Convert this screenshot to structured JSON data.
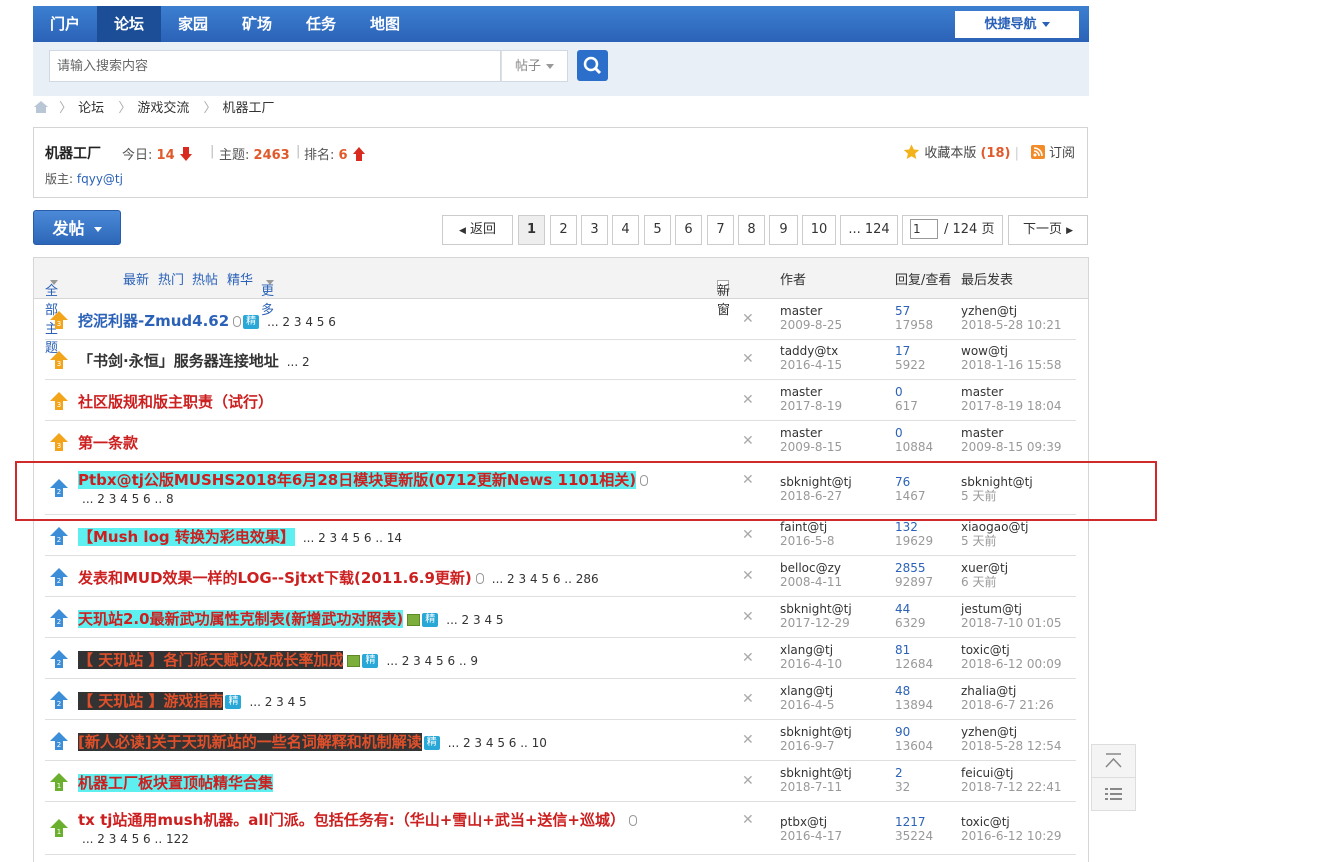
{
  "nav": {
    "items": [
      "门户",
      "论坛",
      "家园",
      "矿场",
      "任务",
      "地图"
    ],
    "active": 1,
    "quick": "快捷导航"
  },
  "search": {
    "placeholder": "请输入搜索内容",
    "type": "帖子"
  },
  "breadcrumb": [
    "论坛",
    "游戏交流",
    "机器工厂"
  ],
  "forum": {
    "name": "机器工厂",
    "today_label": "今日:",
    "today": "14",
    "threads_label": "主题:",
    "threads": "2463",
    "rank_label": "排名:",
    "rank": "6",
    "moderator_label": "版主:",
    "moderator": "fqyy@tj",
    "favorite_label": "收藏本版",
    "favorite_count": "(18)",
    "subscribe_label": "订阅"
  },
  "post_button": "发帖",
  "pager": {
    "prev": "返回",
    "pages": [
      "1",
      "2",
      "3",
      "4",
      "5",
      "6",
      "7",
      "8",
      "9",
      "10"
    ],
    "last": "... 124",
    "current_input": "1",
    "total": "/ 124 页",
    "next": "下一页"
  },
  "list_header": {
    "filters": [
      "全部主题",
      "最新",
      "热门",
      "热帖",
      "精华",
      "更多"
    ],
    "new_window": "新窗",
    "author": "作者",
    "replies": "回复/查看",
    "last_post": "最后发表"
  },
  "colors": {
    "accent": "#2b62b8",
    "red": "#cc1f1f",
    "cyan_hl": "#5ef0f0",
    "dark_hl": "#333333",
    "orange_num": "#e05a2b"
  },
  "threads": [
    {
      "title": "挖泥利器-Zmud4.62",
      "pages": "... 2 3 4 5 6",
      "author": "master",
      "adate": "2009-8-25",
      "replies": "57",
      "views": "17958",
      "last": "yzhen@tj",
      "ldate": "2018-5-28 10:21"
    },
    {
      "title": "「书剑·永恒」服务器连接地址",
      "pages": "... 2",
      "author": "taddy@tx",
      "adate": "2016-4-15",
      "replies": "17",
      "views": "5922",
      "last": "wow@tj",
      "ldate": "2018-1-16 15:58"
    },
    {
      "title": "社区版规和版主职责（试行）",
      "pages": "",
      "author": "master",
      "adate": "2017-8-19",
      "replies": "0",
      "views": "617",
      "last": "master",
      "ldate": "2017-8-19 18:04"
    },
    {
      "title": "第一条款",
      "pages": "",
      "author": "master",
      "adate": "2009-8-15",
      "replies": "0",
      "views": "10884",
      "last": "master",
      "ldate": "2009-8-15 09:39"
    },
    {
      "title": "Ptbx@tj公版MUSHS2018年6月28日模块更新版(0712更新News 1101相关)",
      "pages": "... 2 3 4 5 6 .. 8",
      "author": "sbknight@tj",
      "adate": "2018-6-27",
      "replies": "76",
      "views": "1467",
      "last": "sbknight@tj",
      "ldate": "5 天前"
    },
    {
      "title": "【Mush log 转换为彩电效果】",
      "pages": "... 2 3 4 5 6 .. 14",
      "author": "faint@tj",
      "adate": "2016-5-8",
      "replies": "132",
      "views": "19629",
      "last": "xiaogao@tj",
      "ldate": "5 天前"
    },
    {
      "title": "发表和MUD效果一样的LOG--Sjtxt下载(2011.6.9更新)",
      "pages": "... 2 3 4 5 6 .. 286",
      "author": "belloc@zy",
      "adate": "2008-4-11",
      "replies": "2855",
      "views": "92897",
      "last": "xuer@tj",
      "ldate": "6 天前"
    },
    {
      "title": "天玑站2.0最新武功属性克制表(新增武功对照表)",
      "pages": "... 2 3 4 5",
      "author": "sbknight@tj",
      "adate": "2017-12-29",
      "replies": "44",
      "views": "6329",
      "last": "jestum@tj",
      "ldate": "2018-7-10 01:05"
    },
    {
      "title": "【 天玑站 】各门派天赋以及成长率加成",
      "pages": "... 2 3 4 5 6 .. 9",
      "author": "xlang@tj",
      "adate": "2016-4-10",
      "replies": "81",
      "views": "12684",
      "last": "toxic@tj",
      "ldate": "2018-6-12 00:09"
    },
    {
      "title": "【 天玑站 】游戏指南",
      "pages": "... 2 3 4 5",
      "author": "xlang@tj",
      "adate": "2016-4-5",
      "replies": "48",
      "views": "13894",
      "last": "zhalia@tj",
      "ldate": "2018-6-7 21:26"
    },
    {
      "title": "[新人必读]关于天玑新站的一些名词解释和机制解读",
      "pages": "... 2 3 4 5 6 .. 10",
      "author": "sbknight@tj",
      "adate": "2016-9-7",
      "replies": "90",
      "views": "13604",
      "last": "yzhen@tj",
      "ldate": "2018-5-28 12:54"
    },
    {
      "title": "机器工厂板块置顶帖精华合集",
      "pages": "",
      "author": "sbknight@tj",
      "adate": "2018-7-11",
      "replies": "2",
      "views": "32",
      "last": "feicui@tj",
      "ldate": "2018-7-12 22:41"
    },
    {
      "title": "tx tj站通用mush机器。all门派。包括任务有:（华山+雪山+武当+送信+巡城）",
      "pages": "... 2 3 4 5 6 .. 122",
      "author": "ptbx@tj",
      "adate": "2016-4-17",
      "replies": "1217",
      "views": "35224",
      "last": "toxic@tj",
      "ldate": "2016-6-12 10:29"
    }
  ],
  "badges": {
    "digest": "精"
  }
}
